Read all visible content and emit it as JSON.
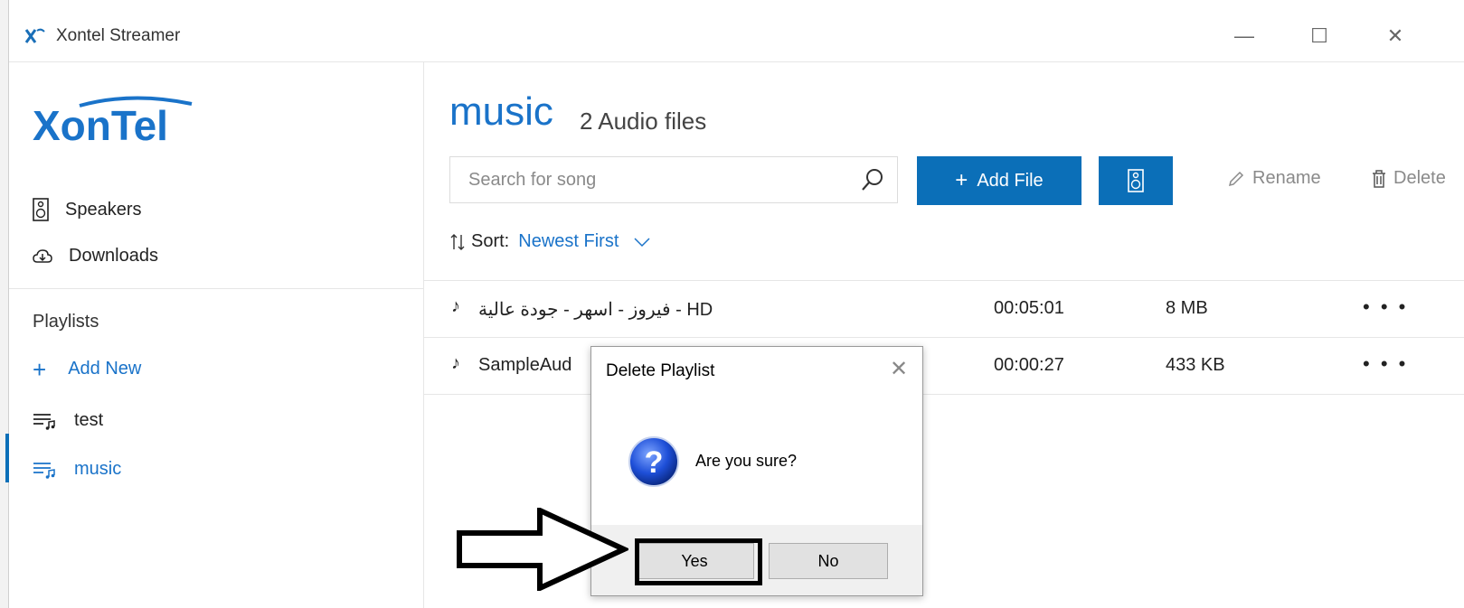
{
  "window": {
    "title": "Xontel Streamer",
    "minimize_glyph": "—",
    "maximize_glyph": "☐",
    "close_glyph": "✕"
  },
  "sidebar": {
    "logo_text": "XonTel",
    "nav": [
      {
        "label": "Speakers",
        "icon": "speaker-icon"
      },
      {
        "label": "Downloads",
        "icon": "cloud-download-icon"
      }
    ],
    "playlists_heading": "Playlists",
    "add_new_label": "Add New",
    "playlists": [
      {
        "label": "test",
        "icon": "playlist-icon",
        "selected": false
      },
      {
        "label": "music",
        "icon": "playlist-icon",
        "selected": true
      }
    ]
  },
  "main": {
    "title": "music",
    "subtitle": "2 Audio files",
    "search": {
      "placeholder": "Search for song"
    },
    "toolbar": {
      "add_file_label": "Add File",
      "rename_label": "Rename",
      "delete_label": "Delete"
    },
    "sort": {
      "label": "Sort:",
      "value": "Newest First"
    },
    "files": [
      {
        "name": "فيروز - اسهر - جودة عالية - HD",
        "duration": "00:05:01",
        "size": "8 MB",
        "more": "• • •"
      },
      {
        "name": "SampleAud",
        "duration": "00:00:27",
        "size": "433 KB",
        "more": "• • •"
      }
    ]
  },
  "dialog": {
    "title": "Delete Playlist",
    "message": "Are you sure?",
    "yes_label": "Yes",
    "no_label": "No"
  },
  "colors": {
    "accent": "#0b6fb8",
    "link": "#1a73c9"
  }
}
